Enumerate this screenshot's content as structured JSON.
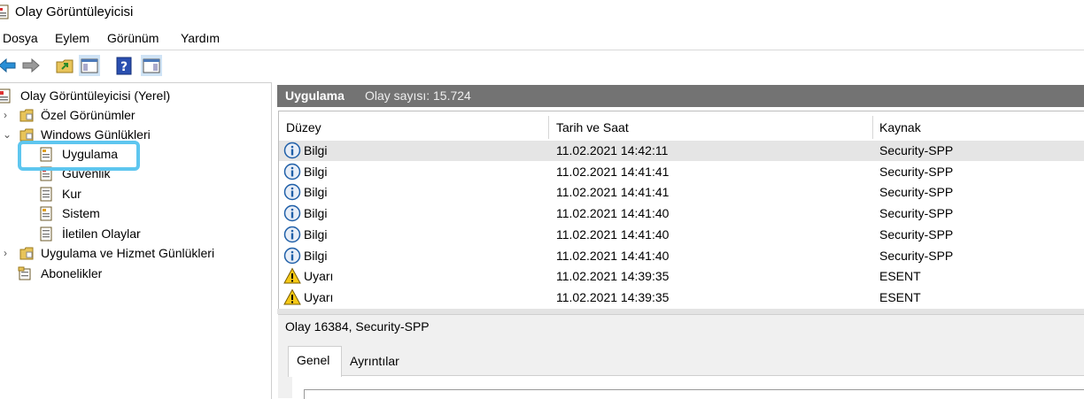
{
  "window": {
    "title": "Olay Görüntüleyicisi"
  },
  "menu": [
    "Dosya",
    "Eylem",
    "Görünüm",
    "Yardım"
  ],
  "tree": {
    "root": "Olay Görüntüleyicisi (Yerel)",
    "custom_views": "Özel Görünümler",
    "windows_logs": "Windows Günlükleri",
    "application": "Uygulama",
    "security": "Güvenlik",
    "setup": "Kur",
    "system": "Sistem",
    "forwarded": "İletilen Olaylar",
    "app_service_logs": "Uygulama ve Hizmet Günlükleri",
    "subscriptions": "Abonelikler"
  },
  "panel": {
    "title": "Uygulama",
    "event_count": "Olay sayısı: 15.724"
  },
  "columns": [
    "Düzey",
    "Tarih ve Saat",
    "Kaynak"
  ],
  "rows": [
    {
      "level": "Bilgi",
      "type": "info",
      "datetime": "11.02.2021 14:42:11",
      "source": "Security-SPP"
    },
    {
      "level": "Bilgi",
      "type": "info",
      "datetime": "11.02.2021 14:41:41",
      "source": "Security-SPP"
    },
    {
      "level": "Bilgi",
      "type": "info",
      "datetime": "11.02.2021 14:41:41",
      "source": "Security-SPP"
    },
    {
      "level": "Bilgi",
      "type": "info",
      "datetime": "11.02.2021 14:41:40",
      "source": "Security-SPP"
    },
    {
      "level": "Bilgi",
      "type": "info",
      "datetime": "11.02.2021 14:41:40",
      "source": "Security-SPP"
    },
    {
      "level": "Bilgi",
      "type": "info",
      "datetime": "11.02.2021 14:41:40",
      "source": "Security-SPP"
    },
    {
      "level": "Uyarı",
      "type": "warning",
      "datetime": "11.02.2021 14:39:35",
      "source": "ESENT"
    },
    {
      "level": "Uyarı",
      "type": "warning",
      "datetime": "11.02.2021 14:39:35",
      "source": "ESENT"
    }
  ],
  "detail": {
    "title": "Olay 16384, Security-SPP",
    "tabs": [
      "Genel",
      "Ayrıntılar"
    ]
  },
  "colors": {
    "highlight": "#5ec6ef",
    "header_bg": "#737373",
    "selected_row": "#e5e5e5",
    "info_blue": "#1f5fa8",
    "warn_yellow": "#f6c915"
  }
}
